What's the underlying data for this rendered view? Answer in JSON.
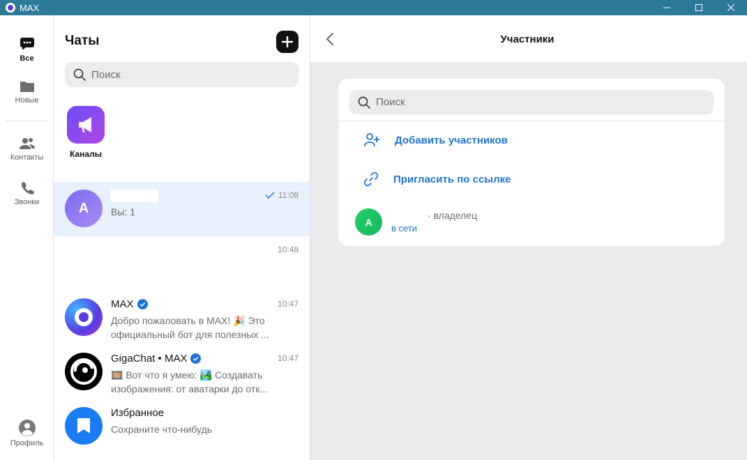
{
  "window": {
    "title": "MAX",
    "minimize": "—",
    "maximize": "☐",
    "close": "✕"
  },
  "rail": {
    "items": [
      {
        "label": "Все",
        "icon": "chat-bubble-icon"
      },
      {
        "label": "Новые",
        "icon": "folder-icon"
      },
      {
        "label": "Контакты",
        "icon": "contacts-icon"
      },
      {
        "label": "Звонки",
        "icon": "phone-icon"
      },
      {
        "label": "Профиль",
        "icon": "profile-icon"
      }
    ]
  },
  "chats": {
    "title": "Чаты",
    "search_placeholder": "Поиск",
    "channels_label": "Каналы",
    "list": [
      {
        "avatar_letter": "A",
        "name": "",
        "time": "11:08",
        "preview": "Вы: 1",
        "read": true
      },
      {
        "name": "",
        "time": "10:48",
        "preview": ""
      },
      {
        "name": "MAX",
        "verified": true,
        "time": "10:47",
        "preview": "Добро пожаловать в MAX! 🎉 Это официальный бот для полезных ..."
      },
      {
        "name": "GigaChat • MAX",
        "verified": true,
        "time": "10:47",
        "preview_line1": "🎞️ Вот что я умею: 🏞️ Создавать",
        "preview_line2": "изображения: от аватарки до отк..."
      },
      {
        "name": "Избранное",
        "time": "",
        "preview": "Сохраните что-нибудь"
      }
    ]
  },
  "members": {
    "title": "Участники",
    "search_placeholder": "Поиск",
    "add_label": "Добавить участников",
    "invite_label": "Пригласить по ссылке",
    "owner": {
      "avatar_letter": "A",
      "role": "· владелец",
      "status": "в сети"
    }
  },
  "colors": {
    "accent": "#1f73d6",
    "titlebar": "#2c7a98",
    "selected_row": "#e8f2ff"
  }
}
